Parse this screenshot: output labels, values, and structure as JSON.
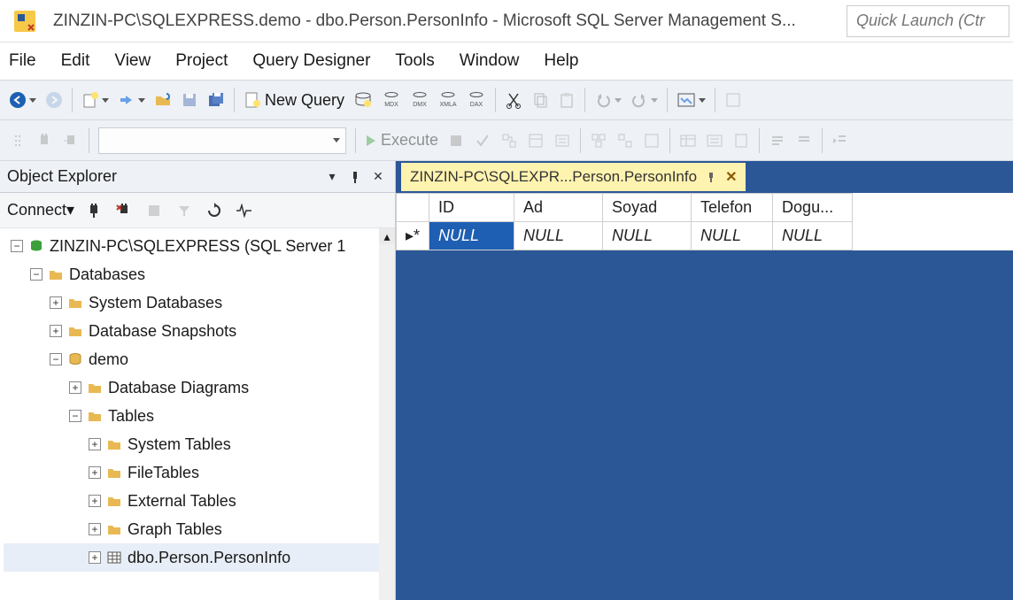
{
  "titlebar": {
    "title": "ZINZIN-PC\\SQLEXPRESS.demo - dbo.Person.PersonInfo - Microsoft SQL Server Management S...",
    "quick_launch_placeholder": "Quick Launch (Ctr"
  },
  "menubar": [
    "File",
    "Edit",
    "View",
    "Project",
    "Query Designer",
    "Tools",
    "Window",
    "Help"
  ],
  "toolbar": {
    "new_query": "New Query",
    "execute": "Execute"
  },
  "object_explorer": {
    "title": "Object Explorer",
    "connect": "Connect",
    "tree": {
      "server": "ZINZIN-PC\\SQLEXPRESS (SQL Server 1",
      "databases": "Databases",
      "system_databases": "System Databases",
      "database_snapshots": "Database Snapshots",
      "demo": "demo",
      "database_diagrams": "Database Diagrams",
      "tables": "Tables",
      "system_tables": "System Tables",
      "file_tables": "FileTables",
      "external_tables": "External Tables",
      "graph_tables": "Graph Tables",
      "person_table": "dbo.Person.PersonInfo"
    }
  },
  "tab": {
    "label": "ZINZIN-PC\\SQLEXPR...Person.PersonInfo"
  },
  "grid": {
    "columns": [
      "ID",
      "Ad",
      "Soyad",
      "Telefon",
      "Dogu..."
    ],
    "row_marker": "▸*",
    "cells": [
      "NULL",
      "NULL",
      "NULL",
      "NULL",
      "NULL"
    ]
  }
}
